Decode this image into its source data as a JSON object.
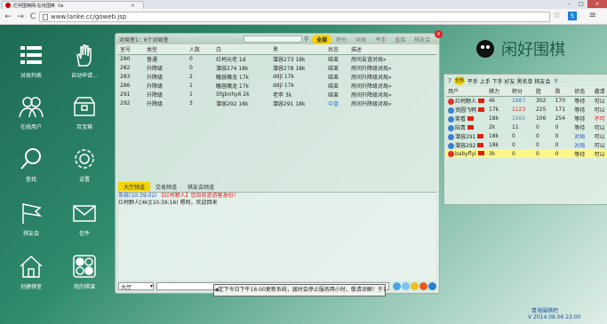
{
  "browser": {
    "tab_title": "烂柯围棋网-在线围棋（la",
    "tab_close": "×",
    "url": "www.lanke.cc/goweb.jsp",
    "back": "←",
    "forward": "→",
    "reload": "C",
    "star": "☆",
    "ext": "S",
    "menu": "≡",
    "win_min": "–",
    "win_max": "□",
    "win_close": "×"
  },
  "desktop": {
    "items": [
      {
        "label": "对局列表",
        "icon": "grid-icon"
      },
      {
        "label": "自动申请...",
        "icon": "hand-icon"
      },
      {
        "label": "在线用户",
        "icon": "users-icon"
      },
      {
        "label": "百宝箱",
        "icon": "treasure-box-icon"
      },
      {
        "label": "查找",
        "icon": "search-icon"
      },
      {
        "label": "设置",
        "icon": "gear-icon"
      },
      {
        "label": "棋友会",
        "icon": "flag-icon"
      },
      {
        "label": "信件",
        "icon": "mail-icon"
      },
      {
        "label": "创建棋室",
        "icon": "house-icon"
      },
      {
        "label": "我的棋谱",
        "icon": "go-board-icon"
      }
    ]
  },
  "room": {
    "title": "对局室1：6个对局室",
    "tabs": [
      {
        "label": "全部",
        "active": true
      },
      {
        "label": "积分",
        "active": false
      },
      {
        "label": "对局",
        "active": false
      },
      {
        "label": "平手",
        "active": false
      },
      {
        "label": "直接",
        "active": false
      },
      {
        "label": "棋友会",
        "active": false
      }
    ],
    "columns": [
      "室号",
      "类型",
      "人数",
      "白",
      "黑",
      "状态",
      "描述"
    ],
    "rows": [
      [
        "280",
        "普通",
        "0",
        "烂柯元老 1d",
        "潜容273 18k",
        "结束",
        "房间友谊对局»"
      ],
      [
        "282",
        "升降级",
        "0",
        "潜容274 18k",
        "潜容278 18k",
        "结束",
        "房间升降级对局»"
      ],
      [
        "283",
        "升降级",
        "2",
        "瞌容魔龙 17k",
        "ddjl 17k",
        "结束",
        "房间升降级对局»"
      ],
      [
        "286",
        "升降级",
        "1",
        "瞌容魔龙 17k",
        "ddjl 17k",
        "结束",
        "房间升降级对局»"
      ],
      [
        "291",
        "升降级",
        "1",
        "5fgbnhy6 2k",
        "老李 3k",
        "结束",
        "房间升降级对局»"
      ],
      [
        "292",
        "升降级",
        "3",
        "潜容292 18k",
        "潜容291 18k",
        "中盘",
        "房间升降级对局»"
      ]
    ],
    "chat_tabs": [
      {
        "label": "大厅频道",
        "active": true
      },
      {
        "label": "交易频道",
        "active": false
      },
      {
        "label": "棋友会频道",
        "active": false
      }
    ],
    "chat": [
      {
        "prefix": "系统(10:39:02)",
        "text": "【烂柯野人】您目前是游客身份！"
      },
      {
        "prefix": "烂柯野人[4k](10:39:16)",
        "text": "嗯呀，欢迎回来"
      }
    ],
    "channel_select": "大厅",
    "close": "×"
  },
  "users": {
    "count": "7",
    "badge": "全部",
    "filters": "平手 上手 下手 好友 黑名单 棋友会",
    "columns": [
      "用户",
      "棋力",
      "积分",
      "胜",
      "败",
      "状态",
      "邀请"
    ],
    "rows": [
      {
        "name": "烂柯野人",
        "rank": "4k",
        "score": "2887",
        "win": "302",
        "lose": "170",
        "status": "等待",
        "invite": "可以",
        "hl": false,
        "rank_color": "#e03030"
      },
      {
        "name": "资圆飞鸭",
        "rank": "17k",
        "score": "1123",
        "win": "225",
        "lose": "171",
        "status": "等待",
        "invite": "可以",
        "hl": false,
        "rank_color": "#3a7fd0"
      },
      {
        "name": "笑看",
        "rank": "18k",
        "score": "1565",
        "win": "106",
        "lose": "254",
        "status": "等待",
        "invite": "不可",
        "hl": false,
        "rank_color": "#3a7fd0"
      },
      {
        "name": "陆青",
        "rank": "2k",
        "score": "11",
        "win": "0",
        "lose": "0",
        "status": "等待",
        "invite": "可以",
        "hl": false,
        "rank_color": "#3a7fd0"
      },
      {
        "name": "潜容291",
        "rank": "18k",
        "score": "0",
        "win": "0",
        "lose": "0",
        "status": "对局",
        "invite": "可以",
        "hl": false,
        "rank_color": "#3a7fd0"
      },
      {
        "name": "潜容292",
        "rank": "18k",
        "score": "0",
        "win": "0",
        "lose": "0",
        "status": "对局",
        "invite": "可以",
        "hl": false,
        "rank_color": "#3a7fd0"
      },
      {
        "name": "babyflyi",
        "rank": "3k",
        "score": "0",
        "win": "0",
        "lose": "0",
        "status": "等待",
        "invite": "可以",
        "hl": true,
        "rank_color": "#e03030"
      }
    ]
  },
  "logo": {
    "text": "闲好围棋"
  },
  "ticker": {
    "text": "定下令日下午16:00更新系统，届时会停止服务两小时，敬请谅解！于18:0"
  },
  "footer": {
    "line1": "青海围棋吧",
    "line2": "V 2014.08.06 22:00"
  }
}
